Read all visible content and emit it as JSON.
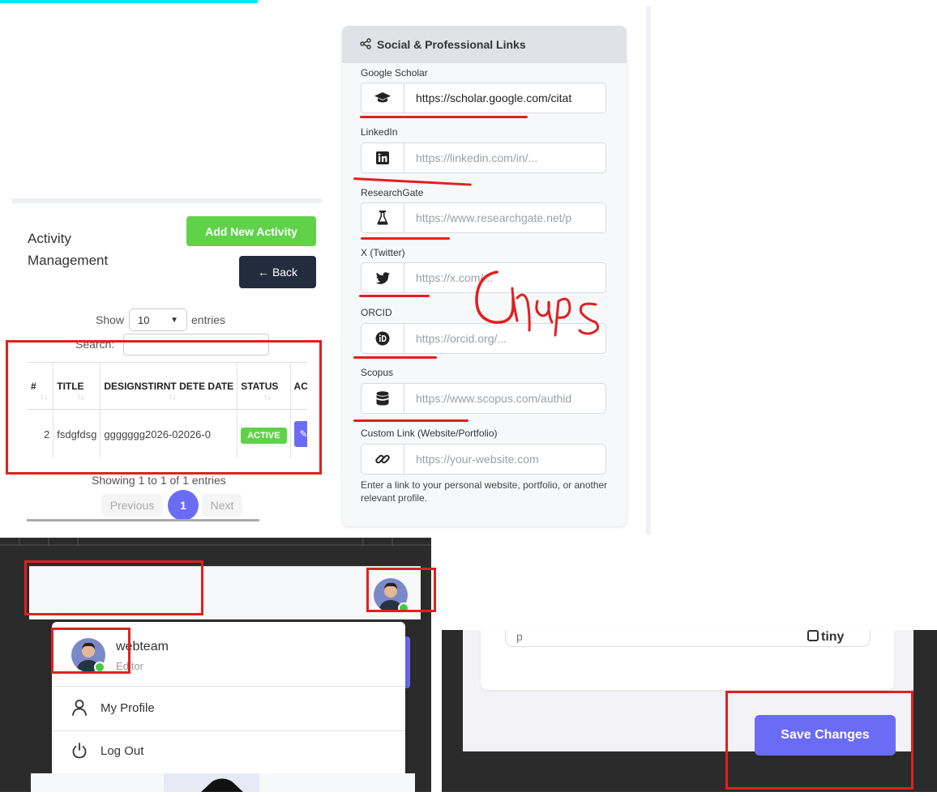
{
  "activity": {
    "title_line1": "Activity",
    "title_line2": "Management",
    "add_label": "Add New Activity",
    "back_label": "Back",
    "show_label": "Show",
    "entries_value": "10",
    "entries_label": "entries",
    "search_label": "Search:",
    "columns": [
      "#",
      "TITLE",
      "DESIGNATION",
      "START DATE",
      "END DATE",
      "STATUS",
      "ACTIONS"
    ],
    "columns_display": [
      "#",
      "TITLE",
      "DESIGNSTIRNT DETE DATE",
      "",
      "",
      "STATUS",
      "ACT"
    ],
    "row": {
      "num": "2",
      "title": "fsdgfdsg",
      "designation": "ggggggg",
      "start": "2026-02026-0",
      "status": "ACTIVE"
    },
    "showing": "Showing 1 to 1 of 1 entries",
    "prev": "Previous",
    "page": "1",
    "next": "Next"
  },
  "social": {
    "header": "Social & Professional Links",
    "fields": [
      {
        "label": "Google Scholar",
        "value": "https://scholar.google.com/citat",
        "icon": "graduation-cap-icon"
      },
      {
        "label": "LinkedIn",
        "placeholder": "https://linkedin.com/in/...",
        "icon": "linkedin-icon"
      },
      {
        "label": "ResearchGate",
        "placeholder": "https://www.researchgate.net/p",
        "icon": "flask-icon"
      },
      {
        "label": "X (Twitter)",
        "placeholder": "https://x.com/...",
        "icon": "twitter-icon"
      },
      {
        "label": "ORCID",
        "placeholder": "https://orcid.org/...",
        "icon": "orcid-icon"
      },
      {
        "label": "Scopus",
        "placeholder": "https://www.scopus.com/authid",
        "icon": "database-icon"
      },
      {
        "label": "Custom Link (Website/Portfolio)",
        "placeholder": "https://your-website.com",
        "icon": "link-icon"
      }
    ],
    "help": "Enter a link to your personal website, portfolio, or another relevant profile."
  },
  "annotation": {
    "handwritten": "Gaps"
  },
  "user_menu": {
    "username": "webteam",
    "role": "Editor",
    "items": [
      "My Profile",
      "Log Out"
    ]
  },
  "editor": {
    "content": "p",
    "brand": "tiny"
  },
  "save_label": "Save Changes",
  "colors": {
    "primary": "#6a6cf5",
    "success": "#5fd24a",
    "dark": "#232b3e",
    "annotation": "#e02020",
    "highlight": "#00e5ff"
  }
}
